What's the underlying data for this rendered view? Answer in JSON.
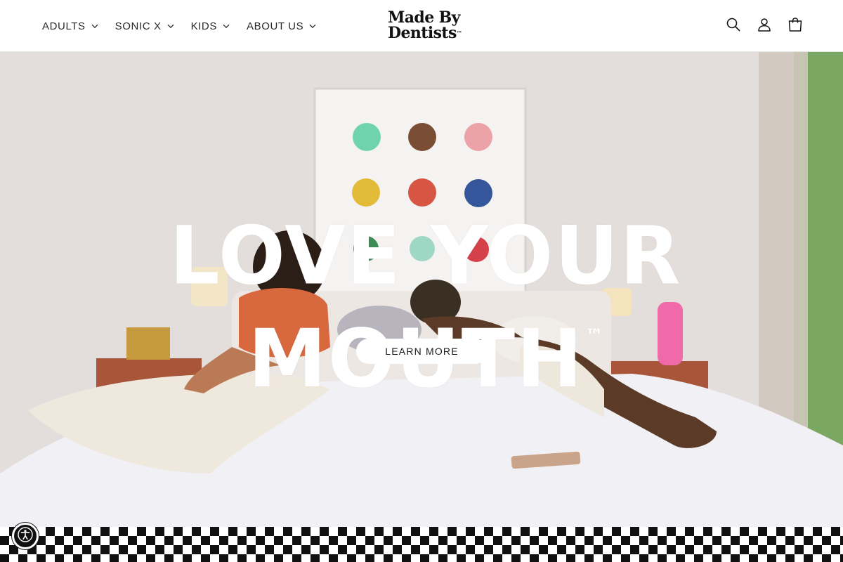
{
  "nav": {
    "items": [
      {
        "label": "ADULTS"
      },
      {
        "label": "SONIC X"
      },
      {
        "label": "KIDS"
      },
      {
        "label": "ABOUT US"
      }
    ]
  },
  "logo": {
    "line1": "Made By",
    "line2": "Dentists",
    "mark": "™"
  },
  "header_icons": [
    "search-icon",
    "account-icon",
    "cart-icon"
  ],
  "hero": {
    "headline": "LOVE YOUR MOUTH",
    "headline_mark": "™",
    "cta_label": "LEARN MORE"
  },
  "accessibility": {
    "icon": "accessibility-icon"
  },
  "colors": {
    "header_bg": "#ffffff",
    "text": "#121212",
    "cta_bg": "#ffffff",
    "checker": "#111111",
    "dot_colors": [
      "#6fd3b0",
      "#7a4d35",
      "#eca3a8",
      "#e2bb38",
      "#d65543",
      "#35569a",
      "#3b8d55",
      "#9ed8c4",
      "#d5414a"
    ]
  }
}
